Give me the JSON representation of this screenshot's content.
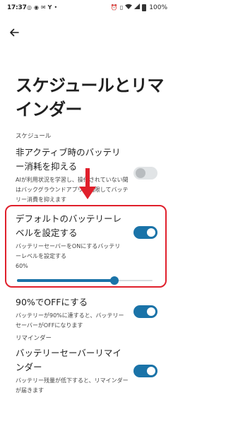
{
  "status_bar": {
    "time": "17:37",
    "left_icons": [
      "whatsapp-icon",
      "chat-icon",
      "mail-icon",
      "yahoo-icon",
      "more-dots-icon"
    ],
    "right_icons": [
      "alarm-icon",
      "vibrate-icon",
      "wifi-icon",
      "signal-icon"
    ],
    "battery": "100%"
  },
  "page": {
    "title": "スケジュールとリマインダー"
  },
  "section_schedule": {
    "header": "スケジュール",
    "adaptive": {
      "title": "非アクティブ時のバッテリー消耗を抑える",
      "subtitle": "AIが利用状況を学習し、操作されていない間はバックグラウンドアプリを制限してバッテリー消費を抑えます",
      "enabled": false
    },
    "default_level": {
      "title": "デフォルトのバッテリーレベルを設定する",
      "subtitle": "バッテリーセーバーをONにするバッテリーレベルを設定する",
      "enabled": true,
      "level_label": "60%",
      "level_value": 0.72
    },
    "off_at_90": {
      "title": "90%でOFFにする",
      "subtitle": "バッテリーが90%に達すると、バッテリーセーバーがOFFになります",
      "enabled": true
    }
  },
  "section_reminder": {
    "header": "リマインダー",
    "reminder": {
      "title": "バッテリーセーバーリマインダー",
      "subtitle": "バッテリー残量が低下すると、リマインダーが届きます",
      "enabled": true
    }
  },
  "colors": {
    "accent": "#1a73a8",
    "annotation_red": "#e0202c"
  }
}
